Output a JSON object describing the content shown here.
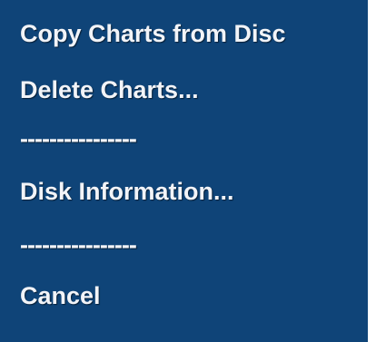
{
  "menu": {
    "background_color": "#0f4478",
    "text_color": "#f2f4f8",
    "items": [
      {
        "label": "Copy Charts from Disc"
      },
      {
        "label": "Delete Charts..."
      },
      {
        "label": "----------------"
      },
      {
        "label": "Disk Information..."
      },
      {
        "label": "----------------"
      },
      {
        "label": "Cancel"
      }
    ]
  }
}
